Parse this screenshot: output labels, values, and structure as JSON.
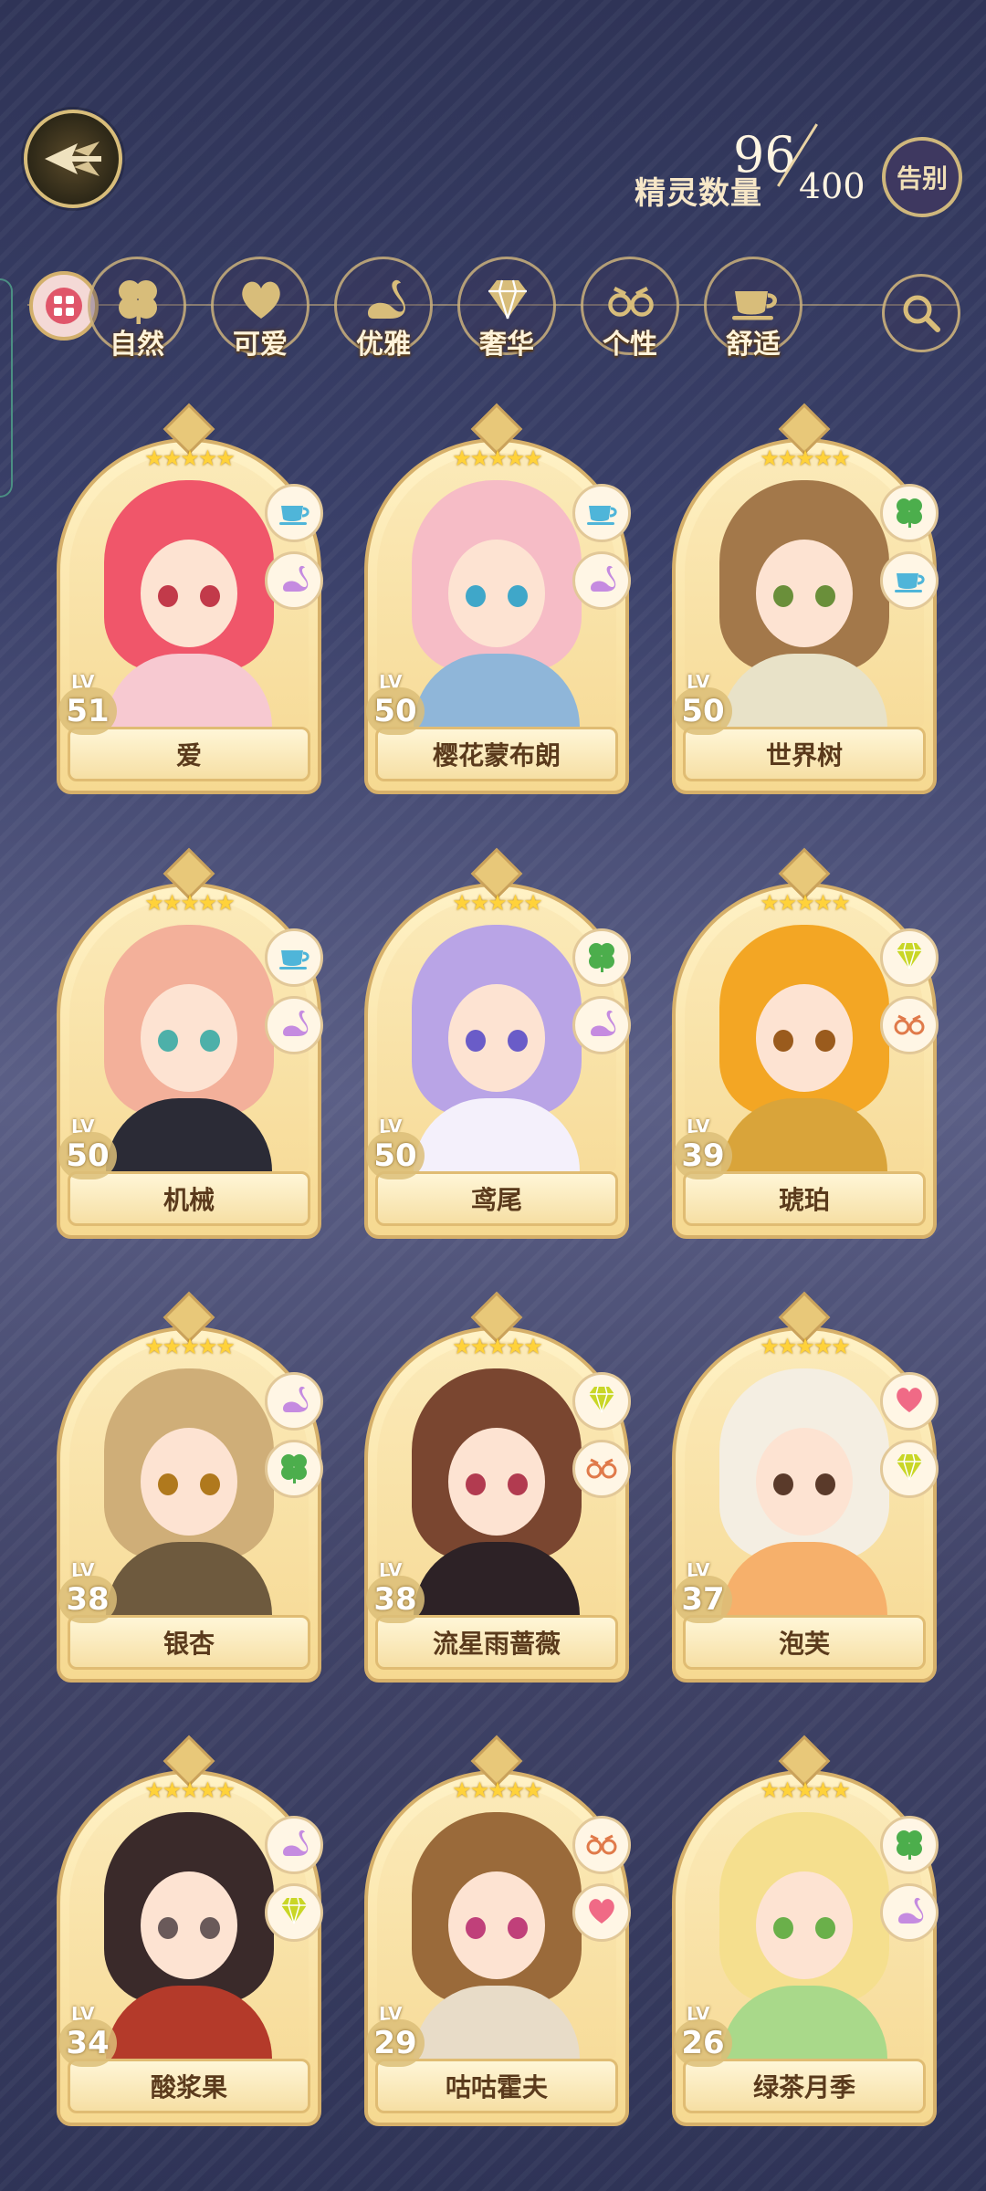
{
  "header": {
    "spirit_count_label": "精灵数量",
    "spirit_count": "96",
    "spirit_max": "400",
    "farewell_label": "告别"
  },
  "filters": [
    {
      "label": "自然",
      "icon": "clover-icon"
    },
    {
      "label": "可爱",
      "icon": "heart-icon"
    },
    {
      "label": "优雅",
      "icon": "swan-icon"
    },
    {
      "label": "奢华",
      "icon": "diamond-icon"
    },
    {
      "label": "个性",
      "icon": "glasses-icon"
    },
    {
      "label": "舒适",
      "icon": "teacup-icon"
    }
  ],
  "spirits": [
    {
      "name": "爱",
      "level": "51",
      "stars": "★★★★★",
      "tags": [
        "teacup-icon",
        "swan-icon"
      ],
      "hair": "#f0566a",
      "eyes": "#c23a4a",
      "outfit": "#f7c9d1"
    },
    {
      "name": "樱花蒙布朗",
      "level": "50",
      "stars": "★★★★★",
      "tags": [
        "teacup-icon",
        "swan-icon"
      ],
      "hair": "#f6bcc6",
      "eyes": "#3fa7c9",
      "outfit": "#8fb6d9"
    },
    {
      "name": "世界树",
      "level": "50",
      "stars": "★★★★★",
      "tags": [
        "clover-icon",
        "teacup-icon"
      ],
      "hair": "#a3784a",
      "eyes": "#6a8f3a",
      "outfit": "#e8e2c8"
    },
    {
      "name": "机械",
      "level": "50",
      "stars": "★★★★★",
      "tags": [
        "teacup-icon",
        "swan-icon"
      ],
      "hair": "#f3b09a",
      "eyes": "#4db0a9",
      "outfit": "#2b2b36"
    },
    {
      "name": "鸢尾",
      "level": "50",
      "stars": "★★★★★",
      "tags": [
        "clover-icon",
        "swan-icon"
      ],
      "hair": "#b9a4e6",
      "eyes": "#6a5cc8",
      "outfit": "#f4f0fb"
    },
    {
      "name": "琥珀",
      "level": "39",
      "stars": "★★★★★",
      "tags": [
        "diamond-icon",
        "glasses-icon"
      ],
      "hair": "#f3a624",
      "eyes": "#9a5b1d",
      "outfit": "#d9a43a"
    },
    {
      "name": "银杏",
      "level": "38",
      "stars": "★★★★★",
      "tags": [
        "swan-icon",
        "clover-icon"
      ],
      "hair": "#cfae78",
      "eyes": "#b0791d",
      "outfit": "#6e5a3e"
    },
    {
      "name": "流星雨蔷薇",
      "level": "38",
      "stars": "★★★★★",
      "tags": [
        "diamond-icon",
        "glasses-icon"
      ],
      "hair": "#7a4630",
      "eyes": "#b23b50",
      "outfit": "#2d2226"
    },
    {
      "name": "泡芙",
      "level": "37",
      "stars": "★★★★★",
      "tags": [
        "heart-icon",
        "diamond-icon"
      ],
      "hair": "#f4eee2",
      "eyes": "#5a3a2a",
      "outfit": "#f6b06b"
    },
    {
      "name": "酸浆果",
      "level": "34",
      "stars": "★★★★★",
      "tags": [
        "swan-icon",
        "diamond-icon"
      ],
      "hair": "#3a2a2a",
      "eyes": "#6a5a5a",
      "outfit": "#b43a2a"
    },
    {
      "name": "咕咕霍夫",
      "level": "29",
      "stars": "★★★★★",
      "tags": [
        "glasses-icon",
        "heart-icon"
      ],
      "hair": "#9a6a3a",
      "eyes": "#c0407a",
      "outfit": "#e8dcc8"
    },
    {
      "name": "绿茶月季",
      "level": "26",
      "stars": "★★★★★",
      "tags": [
        "clover-icon",
        "swan-icon"
      ],
      "hair": "#f5df8e",
      "eyes": "#6ab04a",
      "outfit": "#a9d98a"
    }
  ],
  "colors": {
    "tag_clover": "#4cae4c",
    "tag_heart": "#f06a86",
    "tag_swan": "#c58be0",
    "tag_diamond": "#c9d626",
    "tag_glasses": "#e07a4a",
    "tag_teacup": "#4fb5d9"
  }
}
